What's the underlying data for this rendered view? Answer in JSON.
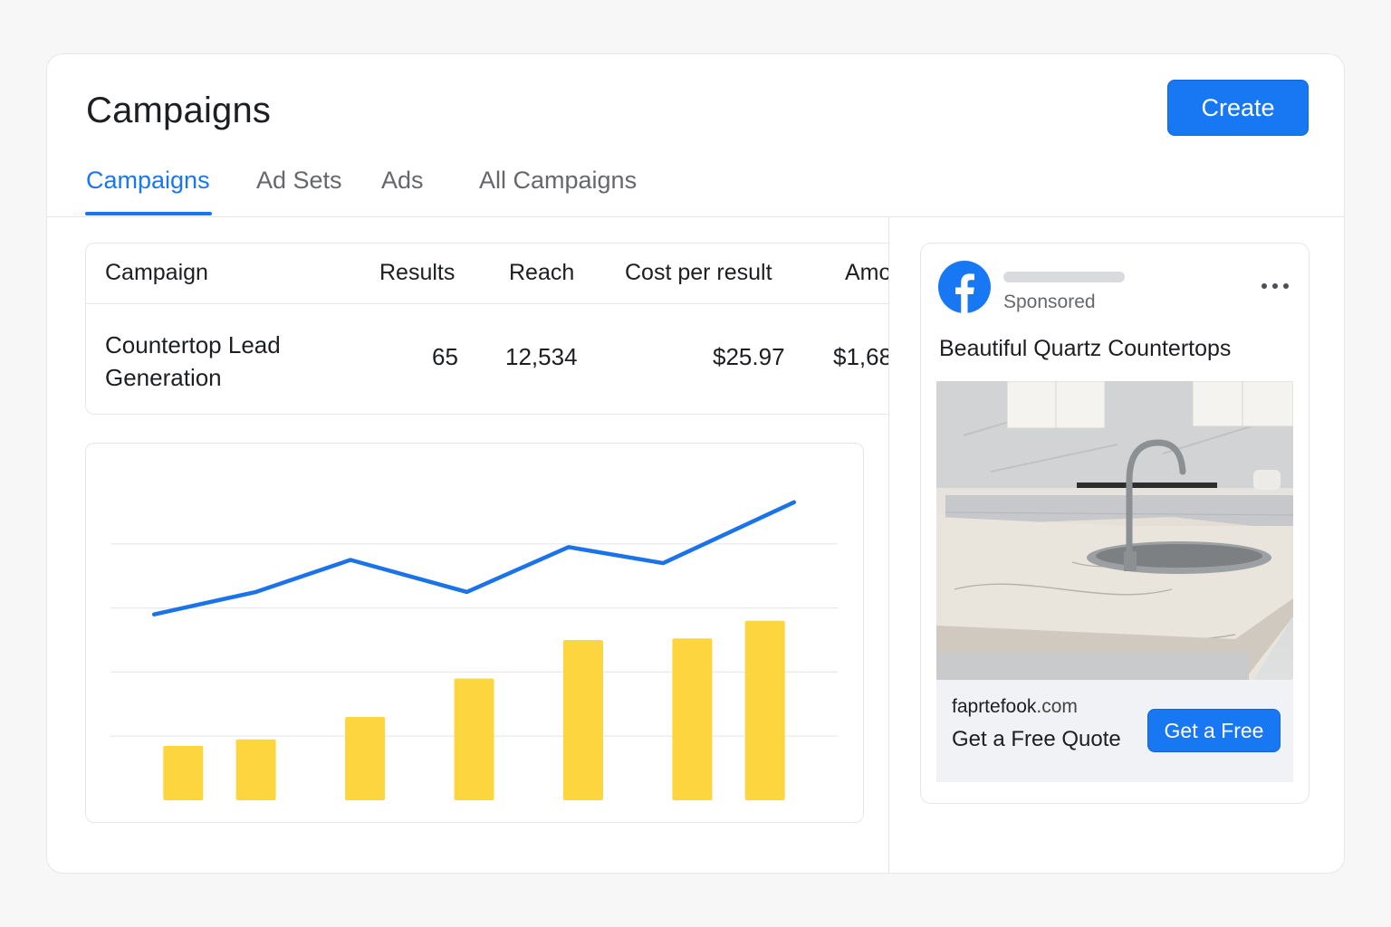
{
  "page": {
    "title": "Campaigns",
    "create_label": "Create"
  },
  "tabs": [
    {
      "label": "Campaigns",
      "active": true
    },
    {
      "label": "Ad Sets",
      "active": false
    },
    {
      "label": "Ads",
      "active": false
    },
    {
      "label": "All Campaigns",
      "active": false
    }
  ],
  "table": {
    "headers": [
      "Campaign",
      "Results",
      "Reach",
      "Cost per result",
      "Amo"
    ],
    "rows": [
      {
        "name": "Countertop Lead Generation",
        "results": "65",
        "reach": "12,534",
        "cost": "$25.97",
        "amount": "$1,68"
      }
    ]
  },
  "colors": {
    "accent": "#1877f2",
    "line": "#1a73e8",
    "bar": "#fdd53f",
    "grid": "#e7e8eb"
  },
  "chart_data": {
    "type": "bar",
    "grid": true,
    "ylim": [
      0,
      100
    ],
    "bars": {
      "x": [
        1,
        2,
        3.5,
        5,
        6.5,
        8,
        9
      ],
      "values": [
        17,
        19,
        26,
        38,
        50,
        50.5,
        56
      ]
    },
    "line": {
      "x": [
        0.6,
        2,
        3.3,
        4.9,
        6.3,
        7.6,
        9.4
      ],
      "values": [
        58,
        65,
        75,
        65,
        79,
        74,
        93
      ]
    }
  },
  "ad": {
    "status": "Sponsored",
    "headline": "Beautiful Quartz Countertops",
    "domain_name": "faprtefook",
    "domain_ext": ".com",
    "cta_text": "Get a Free Quote",
    "button_label": "Get a Free",
    "icons": {
      "logo": "facebook-logo-icon",
      "menu": "more-options-icon"
    }
  }
}
